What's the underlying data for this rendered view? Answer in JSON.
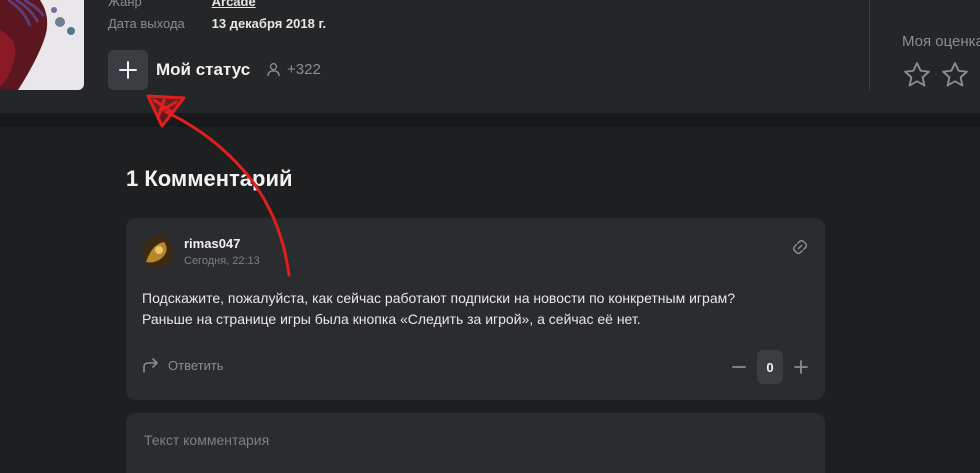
{
  "game": {
    "genre_label": "Жанр",
    "genre_value": "Arcade",
    "release_label": "Дата выхода",
    "release_value": "13 декабря 2018 г.",
    "status_label": "Мой статус",
    "followers_count": "+322",
    "my_rating_label": "Моя оценка"
  },
  "comments": {
    "title": "1 Комментарий",
    "items": [
      {
        "author": "rimas047",
        "time": "Сегодня, 22:13",
        "text": "Подскажите, пожалуйста, как сейчас работают подписки на новости по конкретным играм? Раньше на странице игры была кнопка «Следить за игрой», а сейчас её нет.",
        "reply_label": "Ответить",
        "votes": "0"
      }
    ],
    "editor_placeholder": "Текст комментария"
  },
  "icons": {
    "plus": "plus-icon",
    "user": "user-icon",
    "star": "star-icon",
    "link": "link-icon",
    "reply": "reply-arrow-icon",
    "minus": "minus-icon"
  },
  "colors": {
    "background": "#1d1f21",
    "panel": "#242628",
    "card": "#2a2c2f",
    "button": "#3a3d41",
    "muted": "#8a8d91",
    "annotation": "#e01e1e"
  }
}
